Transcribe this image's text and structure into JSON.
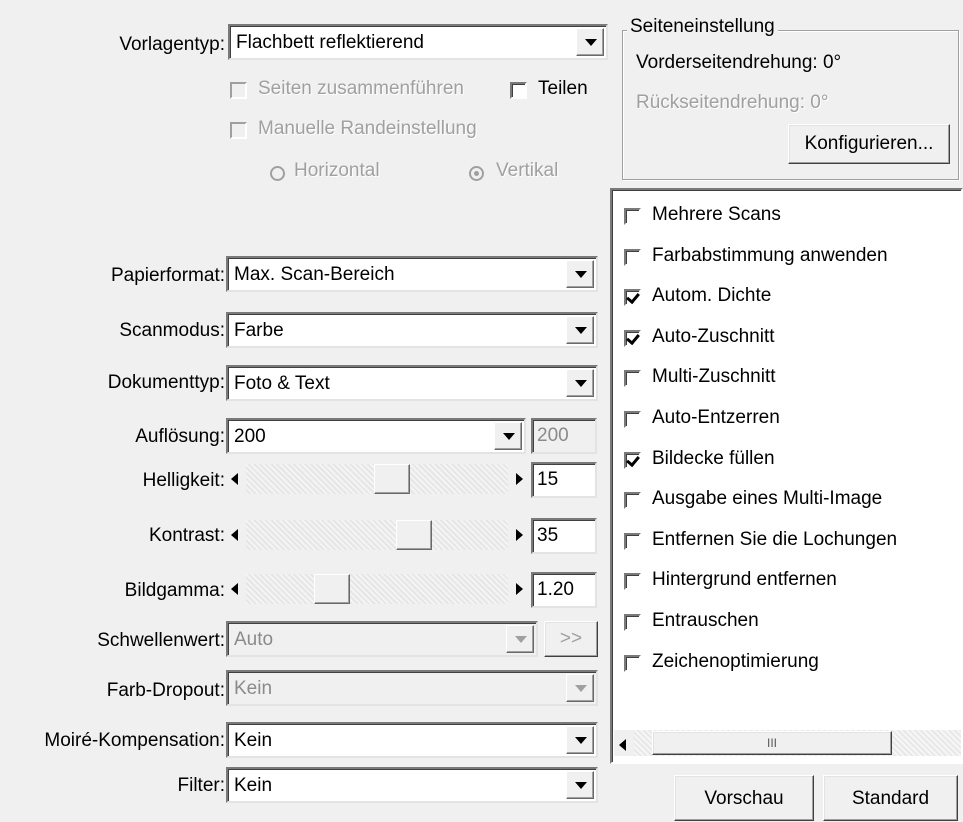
{
  "left": {
    "vorlagentyp": {
      "label": "Vorlagentyp:",
      "value": "Flachbett reflektierend"
    },
    "seiten_zusammen": {
      "label": "Seiten zusammenführen",
      "checked": false,
      "enabled": false
    },
    "teilen": {
      "label": "Teilen",
      "checked": false,
      "enabled": true
    },
    "manuelle_rand": {
      "label": "Manuelle Randeinstellung",
      "checked": false,
      "enabled": false
    },
    "radio_horizontal": {
      "label": "Horizontal",
      "selected": false
    },
    "radio_vertikal": {
      "label": "Vertikal",
      "selected": true
    },
    "papierformat": {
      "label": "Papierformat:",
      "value": "Max. Scan-Bereich"
    },
    "scanmodus": {
      "label": "Scanmodus:",
      "value": "Farbe"
    },
    "dokumenttyp": {
      "label": "Dokumenttyp:",
      "value": "Foto & Text"
    },
    "aufloesung": {
      "label": "Auflösung:",
      "value": "200",
      "readout": "200"
    },
    "helligkeit": {
      "label": "Helligkeit:",
      "value": "15"
    },
    "kontrast": {
      "label": "Kontrast:",
      "value": "35"
    },
    "bildgamma": {
      "label": "Bildgamma:",
      "value": "1.20"
    },
    "schwellenwert": {
      "label": "Schwellenwert:",
      "value": "Auto",
      "button": ">>"
    },
    "farb_dropout": {
      "label": "Farb-Dropout:",
      "value": "Kein"
    },
    "moire": {
      "label": "Moiré-Kompensation:",
      "value": "Kein"
    },
    "filter": {
      "label": "Filter:",
      "value": "Kein"
    }
  },
  "seiteneinstellung": {
    "title": "Seiteneinstellung",
    "vorderseite": "Vorderseitendrehung: 0°",
    "rueckseite": "Rückseitendrehung: 0°",
    "konfigurieren": "Konfigurieren..."
  },
  "options": [
    {
      "label": "Mehrere Scans",
      "checked": false
    },
    {
      "label": "Farbabstimmung anwenden",
      "checked": false
    },
    {
      "label": "Autom. Dichte",
      "checked": true
    },
    {
      "label": "Auto-Zuschnitt",
      "checked": true
    },
    {
      "label": "Multi-Zuschnitt",
      "checked": false
    },
    {
      "label": "Auto-Entzerren",
      "checked": false
    },
    {
      "label": "Bildecke füllen",
      "checked": true
    },
    {
      "label": "Ausgabe eines Multi-Image",
      "checked": false
    },
    {
      "label": "Entfernen Sie die Lochungen",
      "checked": false
    },
    {
      "label": "Hintergrund entfernen",
      "checked": false
    },
    {
      "label": "Entrauschen",
      "checked": false
    },
    {
      "label": "Zeichenoptimierung",
      "checked": false
    }
  ],
  "scroll_grip": "III",
  "buttons": {
    "vorschau": "Vorschau",
    "standard": "Standard"
  }
}
